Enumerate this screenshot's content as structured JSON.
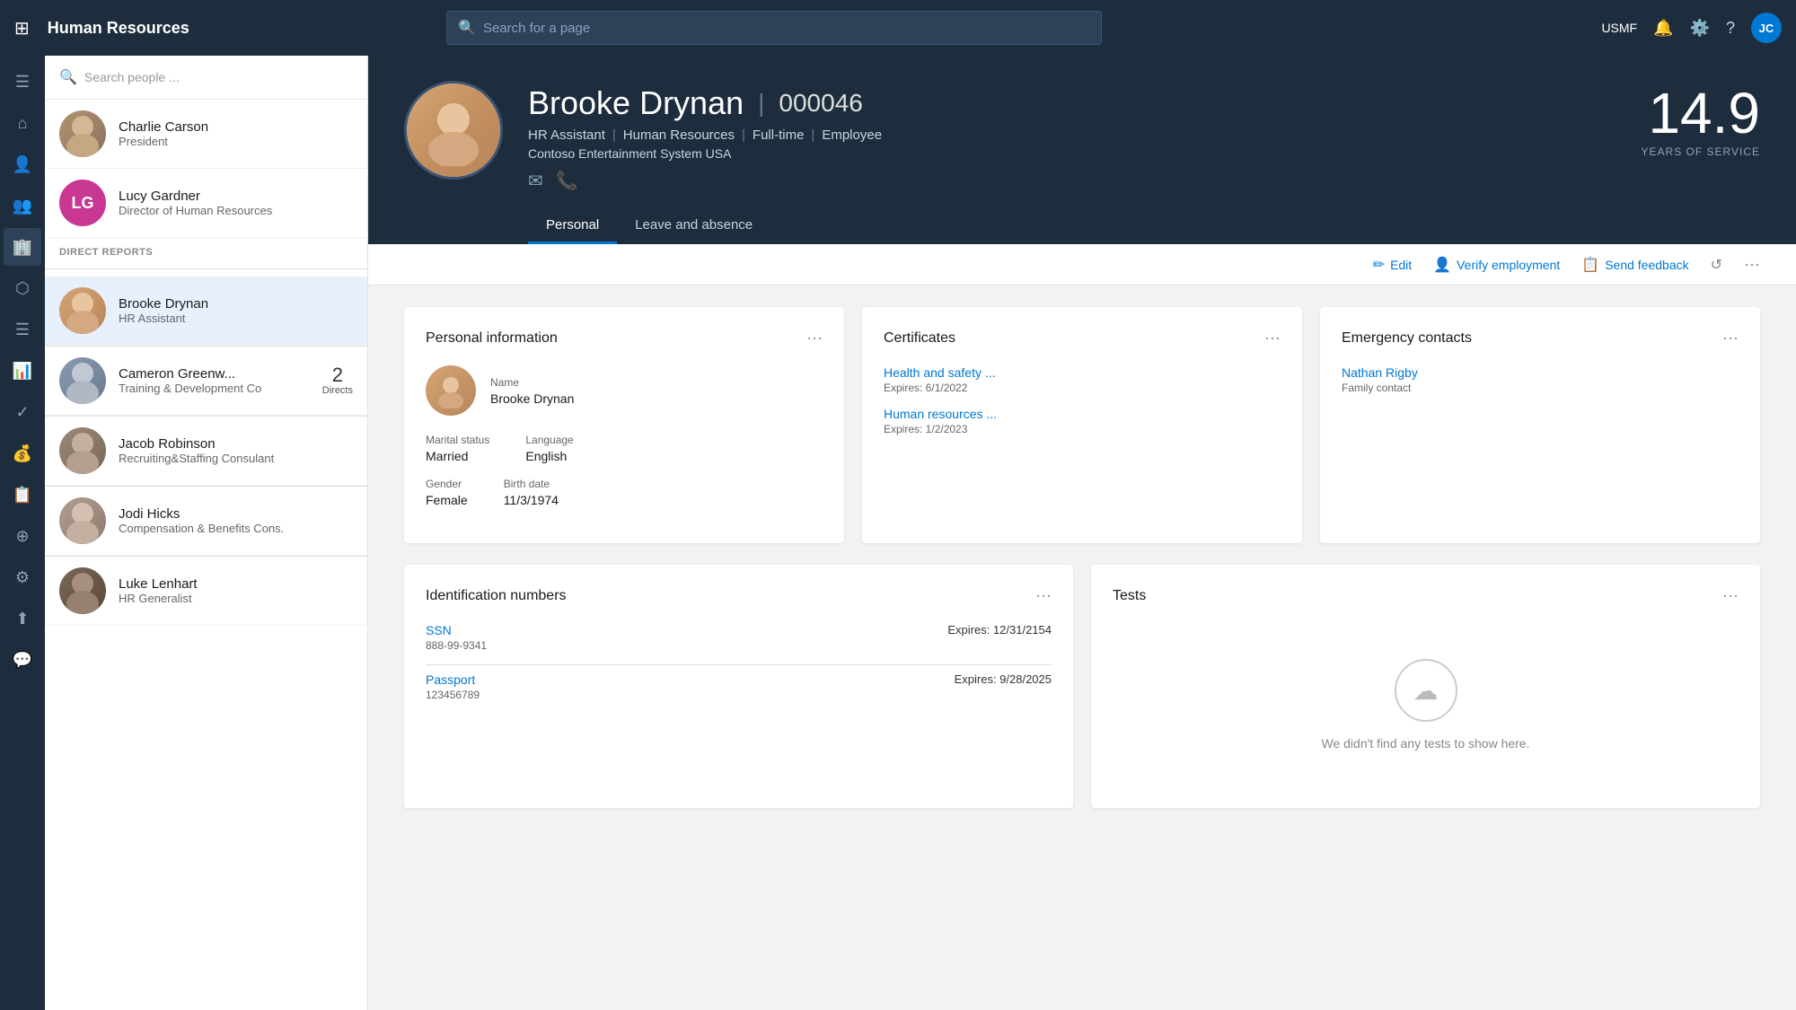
{
  "topNav": {
    "title": "Human Resources",
    "searchPlaceholder": "Search for a page",
    "region": "USMF",
    "userInitials": "JC"
  },
  "sidebar": {
    "searchPlaceholder": "Search people ...",
    "managedBy": {
      "name": "Charlie Carson",
      "title": "President",
      "avatarType": "photo",
      "avatarColor": "#7a6a5a"
    },
    "lucyGardner": {
      "name": "Lucy Gardner",
      "title": "Director of Human Resources",
      "initials": "LG",
      "avatarColor": "#c83791"
    },
    "directReportsLabel": "DIRECT REPORTS",
    "directReports": [
      {
        "name": "Brooke Drynan",
        "title": "HR Assistant",
        "directs": null,
        "selected": true
      },
      {
        "name": "Cameron Greenw...",
        "title": "Training & Development Co",
        "directs": 2,
        "directsLabel": "Directs"
      },
      {
        "name": "Jacob Robinson",
        "title": "Recruiting&Staffing Consulant",
        "directs": null
      },
      {
        "name": "Jodi Hicks",
        "title": "Compensation & Benefits Cons.",
        "directs": null
      },
      {
        "name": "Luke Lenhart",
        "title": "HR Generalist",
        "directs": null
      }
    ]
  },
  "profile": {
    "name": "Brooke Drynan",
    "id": "000046",
    "jobTitle": "HR Assistant",
    "department": "Human Resources",
    "type": "Full-time",
    "role": "Employee",
    "company": "Contoso Entertainment System USA",
    "yearsOfService": "14.9",
    "yearsLabel": "YEARS OF SERVICE",
    "tabs": [
      {
        "label": "Personal",
        "active": true
      },
      {
        "label": "Leave and absence",
        "active": false
      }
    ]
  },
  "toolbar": {
    "editLabel": "Edit",
    "verifyLabel": "Verify employment",
    "feedbackLabel": "Send feedback"
  },
  "personalInfo": {
    "cardTitle": "Personal information",
    "nameLabel": "Name",
    "nameValue": "Brooke Drynan",
    "maritalLabel": "Marital status",
    "maritalValue": "Married",
    "languageLabel": "Language",
    "languageValue": "English",
    "genderLabel": "Gender",
    "genderValue": "Female",
    "birthLabel": "Birth date",
    "birthValue": "11/3/1974"
  },
  "certificates": {
    "cardTitle": "Certificates",
    "items": [
      {
        "name": "Health and safety ...",
        "expires": "Expires: 6/1/2022"
      },
      {
        "name": "Human resources ...",
        "expires": "Expires: 1/2/2023"
      }
    ]
  },
  "emergencyContacts": {
    "cardTitle": "Emergency contacts",
    "contacts": [
      {
        "name": "Nathan Rigby",
        "type": "Family contact"
      }
    ]
  },
  "identificationNumbers": {
    "cardTitle": "Identification numbers",
    "items": [
      {
        "type": "SSN",
        "number": "888-99-9341",
        "expires": "Expires: 12/31/2154"
      },
      {
        "type": "Passport",
        "number": "123456789",
        "expires": "Expires: 9/28/2025"
      }
    ]
  },
  "tests": {
    "cardTitle": "Tests",
    "emptyMessage": "We didn't find any tests to show here."
  }
}
